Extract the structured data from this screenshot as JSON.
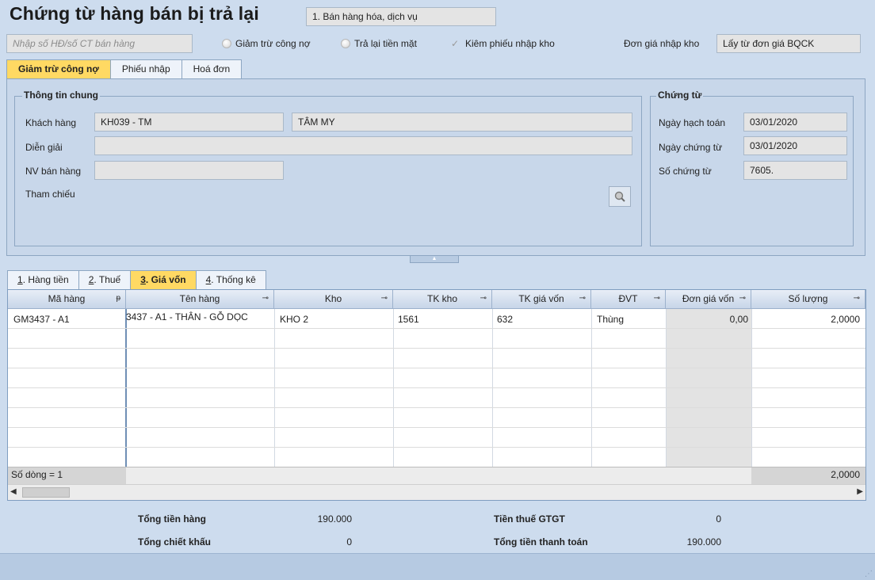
{
  "header": {
    "title": "Chứng từ hàng bán bị trả lại",
    "type_select": "1. Bán hàng hóa, dịch vụ",
    "search_placeholder": "Nhập số HĐ/số CT bán hàng",
    "radio_deduct": "Giảm trừ công nợ",
    "radio_cash": "Trả lại tiền mặt",
    "check_receipt": "Kiêm phiếu nhập kho",
    "unit_price_label": "Đơn giá nhập kho",
    "unit_price_value": "Lấy từ đơn giá BQCK"
  },
  "tabs_top": [
    "Giảm trừ công nợ",
    "Phiếu nhập",
    "Hoá đơn"
  ],
  "general": {
    "title": "Thông tin chung",
    "customer_label": "Khách hàng",
    "customer_code": "KH039 - TM",
    "customer_name": "TÂM MY",
    "desc_label": "Diễn giải",
    "desc_value": "",
    "staff_label": "NV bán hàng",
    "staff_value": "",
    "ref_label": "Tham chiếu"
  },
  "voucher": {
    "title": "Chứng từ",
    "posting_date_label": "Ngày hạch toán",
    "posting_date": "03/01/2020",
    "voucher_date_label": "Ngày chứng từ",
    "voucher_date": "03/01/2020",
    "voucher_no_label": "Số chứng từ",
    "voucher_no": "7605."
  },
  "tabs_bottom": {
    "t1_num": "1",
    "t1_text": ". Hàng tiền",
    "t2_num": "2",
    "t2_text": ". Thuế",
    "t3_num": "3",
    "t3_text": ". Giá vốn",
    "t4_num": "4",
    "t4_text": ". Thống kê"
  },
  "grid": {
    "headers": {
      "code": "Mã hàng",
      "name": "Tên hàng",
      "warehouse": "Kho",
      "stock_acc": "TK kho",
      "cost_acc": "TK giá vốn",
      "unit": "ĐVT",
      "unit_cost": "Đơn giá vốn",
      "qty": "Số lượng"
    },
    "row1": {
      "code": "GM3437 - A1",
      "name": "3437 - A1 - THÂN - GỖ DỌC",
      "warehouse": "KHO 2",
      "stock_acc": "1561",
      "cost_acc": "632",
      "unit": "Thùng",
      "unit_cost": "0,00",
      "qty": "2,0000"
    },
    "row_count": "Số dòng = 1",
    "qty_total": "2,0000"
  },
  "totals": {
    "goods_label": "Tổng tiền hàng",
    "goods_value": "190.000",
    "discount_label": "Tổng chiết khấu",
    "discount_value": "0",
    "vat_label": "Tiền thuế GTGT",
    "vat_value": "0",
    "payment_label": "Tổng tiền thanh toán",
    "payment_value": "190.000"
  }
}
